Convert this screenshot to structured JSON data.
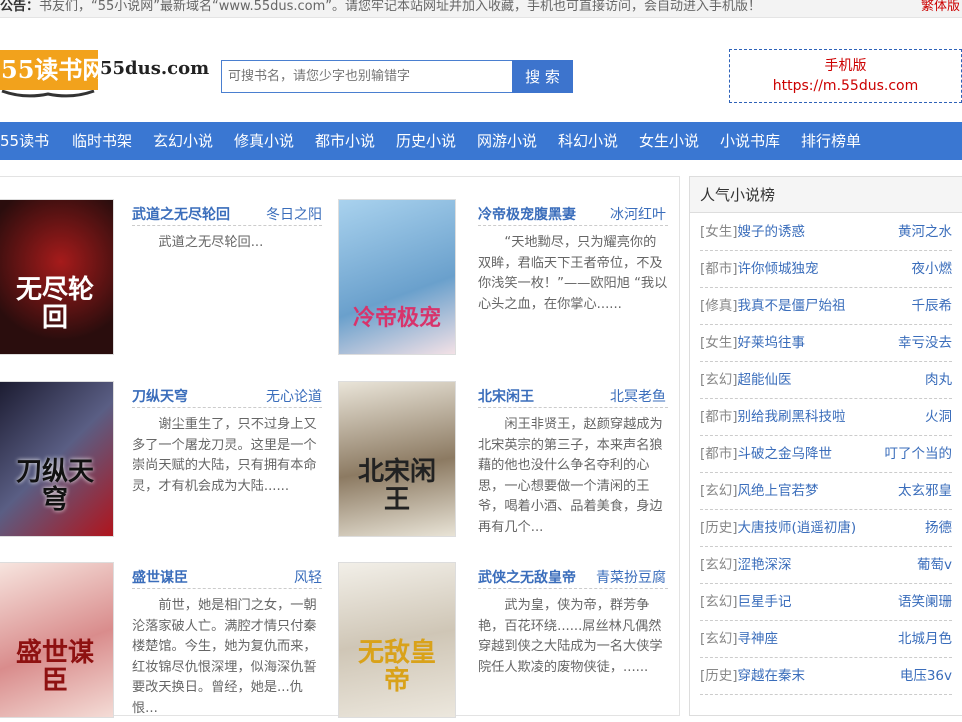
{
  "notice": {
    "lead": "公告：",
    "text": "书友们，“55小说网”最新域名“www.55dus.com”。请您牢记本站网址并加入收藏，手机也可直接访问，会自动进入手机版！",
    "traditional": "繁体版"
  },
  "logo": {
    "text": "55读书网",
    "domain": "55dus.com"
  },
  "search": {
    "placeholder": "可搜书名，请您少字也别输错字",
    "button": "搜 索"
  },
  "mobile": {
    "label": "手机版",
    "url": "https://m.55dus.com"
  },
  "nav": [
    "55读书",
    "临时书架",
    "玄幻小说",
    "修真小说",
    "都市小说",
    "历史小说",
    "网游小说",
    "科幻小说",
    "女生小说",
    "小说书库",
    "排行榜单"
  ],
  "books": [
    {
      "title": "武道之无尽轮回",
      "author": "冬日之阳",
      "desc": "武道之无尽轮回...",
      "cover_text": "无尽轮回",
      "cover_bg": "#2a0d0d"
    },
    {
      "title": "冷帝极宠腹黑妻",
      "author": "冰河红叶",
      "desc": "“天地黝尽，只为耀亮你的双眸，君临天下王者帝位，不及你浅笑一枚！”——欧阳旭 “我以心头之血，在你掌心......",
      "cover_text": "冷帝极宠",
      "cover_bg": "#7fb3d8"
    },
    {
      "title": "刀纵天穹",
      "author": "无心论道",
      "desc": "谢尘重生了，只不过身上又多了一个屠龙刀灵。这里是一个崇尚天赋的大陆，只有拥有本命灵，才有机会成为大陆......",
      "cover_text": "刀纵天穹",
      "cover_bg": "#3a3a52"
    },
    {
      "title": "北宋闲王",
      "author": "北冥老鱼",
      "desc": "闲王非贤王，赵颜穿越成为北宋英宗的第三子，本来声名狼藉的他也没什么争名夺利的心思，一心想要做一个清闲的王爷，喝着小酒、品着美食，身边再有几个...",
      "cover_text": "北宋闲王",
      "cover_bg": "#c9c2b4"
    },
    {
      "title": "盛世谋臣",
      "author": "风轻",
      "desc": "前世，她是相门之女，一朝沦落家破人亡。满腔才情只付秦楼楚馆。今生，她为复仇而来，红妆锦尽仇恨深埋，似海深仇誓要改天换日。曾经，她是...仇恨...",
      "cover_text": "盛世谋臣",
      "cover_bg": "#f1d9d4"
    },
    {
      "title": "武侠之无敌皇帝",
      "author": "青菜扮豆腐",
      "desc": "武为皇，侠为帝，群芳争艳，百花环绕......屌丝林凡偶然穿越到侠之大陆成为一名大侠学院任人欺凌的废物侠徒，......",
      "cover_text": "无敌皇帝",
      "cover_bg": "#e8e4dc"
    }
  ],
  "side": {
    "title": "人气小说榜",
    "items": [
      {
        "cat": "[女生]",
        "name": "嫂子的诱惑",
        "author": "黄河之水"
      },
      {
        "cat": "[都市]",
        "name": "许你倾城独宠",
        "author": "夜小燃"
      },
      {
        "cat": "[修真]",
        "name": "我真不是僵尸始祖",
        "author": "千辰希"
      },
      {
        "cat": "[女生]",
        "name": "好莱坞往事",
        "author": "幸亏没去"
      },
      {
        "cat": "[玄幻]",
        "name": "超能仙医",
        "author": "肉丸"
      },
      {
        "cat": "[都市]",
        "name": "别给我刷黑科技啦",
        "author": "火洞"
      },
      {
        "cat": "[都市]",
        "name": "斗破之金乌降世",
        "author": "叮了个当的"
      },
      {
        "cat": "[玄幻]",
        "name": "风绝上官若梦",
        "author": "太玄邪皇"
      },
      {
        "cat": "[历史]",
        "name": "大唐技师(逍遥初唐)",
        "author": "扬德"
      },
      {
        "cat": "[玄幻]",
        "name": "涩艳深深",
        "author": "葡萄v"
      },
      {
        "cat": "[玄幻]",
        "name": "巨星手记",
        "author": "语笑阑珊"
      },
      {
        "cat": "[玄幻]",
        "name": "寻神座",
        "author": "北城月色"
      },
      {
        "cat": "[历史]",
        "name": "穿越在秦末",
        "author": "电压36v"
      }
    ]
  }
}
